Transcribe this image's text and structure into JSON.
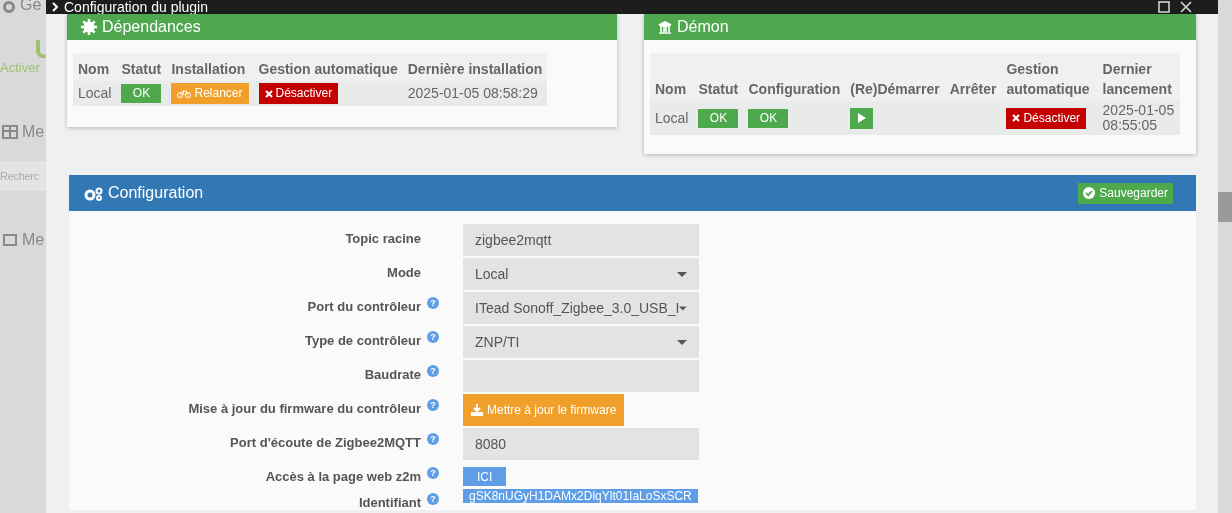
{
  "background": {
    "items": [
      {
        "kind": "header",
        "text": "Ge"
      },
      {
        "kind": "action",
        "text": "Activer"
      },
      {
        "kind": "header",
        "text": "Me"
      },
      {
        "kind": "search",
        "placeholder": "Recherc"
      },
      {
        "kind": "header",
        "text": "Me"
      }
    ]
  },
  "modal": {
    "title": "Configuration du plugin",
    "dependencies": {
      "title": "Dépendances",
      "columns": [
        "Nom",
        "Statut",
        "Installation",
        "Gestion automatique",
        "Dernière installation"
      ],
      "rows": [
        {
          "cells": [
            {
              "kind": "text",
              "text": "Local"
            },
            {
              "kind": "status",
              "text": "OK"
            },
            {
              "kind": "relaunch",
              "text": "Relancer"
            },
            {
              "kind": "disable",
              "text": "Désactiver"
            },
            {
              "kind": "text",
              "text": "2025-01-05 08:58:29"
            }
          ]
        }
      ]
    },
    "daemon": {
      "title": "Démon",
      "columns": [
        "Nom",
        "Statut",
        "Configuration",
        "(Re)Démarrer",
        "Arrêter",
        "Gestion automatique",
        "Dernier lancement"
      ],
      "rows": [
        {
          "cells": [
            {
              "kind": "text",
              "text": "Local"
            },
            {
              "kind": "status",
              "text": "OK"
            },
            {
              "kind": "status",
              "text": "OK"
            },
            {
              "kind": "start"
            },
            {
              "kind": "empty"
            },
            {
              "kind": "disable",
              "text": "Désactiver"
            },
            {
              "kind": "text",
              "text": "2025-01-05 08:55:05"
            }
          ]
        }
      ]
    },
    "configuration": {
      "title": "Configuration",
      "save_button": "Sauvegarder",
      "fields": [
        {
          "label": "Topic racine",
          "kind": "input",
          "value": "zigbee2mqtt"
        },
        {
          "label": "Mode",
          "kind": "select",
          "value": "Local"
        },
        {
          "label": "Port du contrôleur",
          "help": "?",
          "kind": "select",
          "value": "ITead Sonoff_Zigbee_3.0_USB_I"
        },
        {
          "label": "Type de contrôleur",
          "help": "?",
          "kind": "select",
          "value": "ZNP/TI"
        },
        {
          "label": "Baudrate",
          "help": "?",
          "kind": "input"
        },
        {
          "label": "Mise à jour du firmware du contrôleur",
          "help": "?",
          "kind": "button",
          "value": "Mettre à jour le firmware"
        },
        {
          "label": "Port d'écoute de Zigbee2MQTT",
          "help": "?",
          "kind": "input",
          "value": "8080"
        },
        {
          "label": "Accès à la page web z2m",
          "help": "?",
          "kind": "link",
          "value": "ICI"
        },
        {
          "label": "Identifiant",
          "help": "?",
          "kind": "token",
          "value": "gSK8nUGyH1DAMx2DlqYlt01IaLoSxSCR"
        }
      ]
    }
  }
}
